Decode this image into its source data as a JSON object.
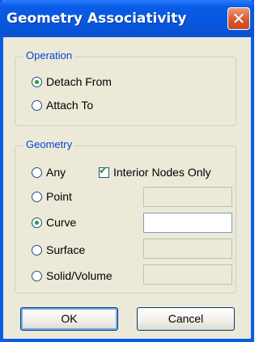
{
  "window": {
    "title": "Geometry Associativity",
    "close_symbol": "✕"
  },
  "operation": {
    "label": "Operation",
    "options": [
      {
        "label": "Detach From",
        "selected": true
      },
      {
        "label": "Attach To",
        "selected": false
      }
    ]
  },
  "geometry": {
    "label": "Geometry",
    "interior_nodes_only": {
      "label": "Interior Nodes Only",
      "checked": true
    },
    "options": [
      {
        "label": "Any",
        "selected": false
      },
      {
        "label": "Point",
        "selected": false,
        "value": ""
      },
      {
        "label": "Curve",
        "selected": true,
        "value": ""
      },
      {
        "label": "Surface",
        "selected": false,
        "value": ""
      },
      {
        "label": "Solid/Volume",
        "selected": false,
        "value": ""
      }
    ]
  },
  "buttons": {
    "ok": "OK",
    "cancel": "Cancel"
  }
}
